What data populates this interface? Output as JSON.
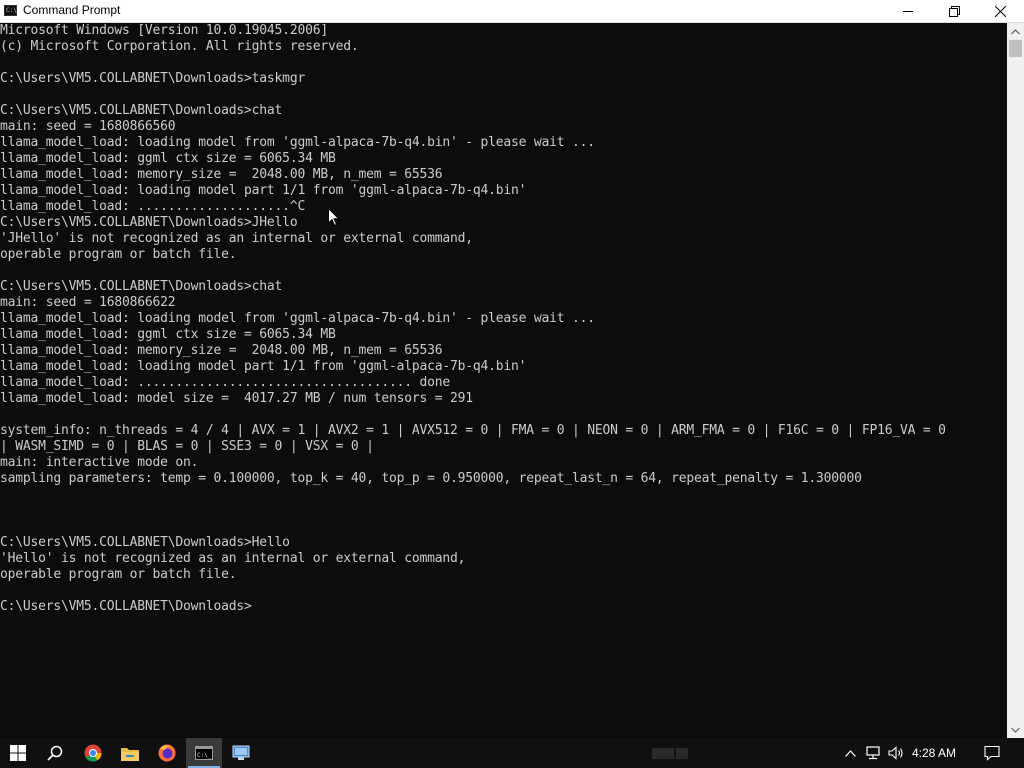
{
  "window": {
    "title": "Command Prompt",
    "app_icon_text": "C:\\"
  },
  "console": {
    "lines": [
      "Microsoft Windows [Version 10.0.19045.2006]",
      "(c) Microsoft Corporation. All rights reserved.",
      "",
      "C:\\Users\\VM5.COLLABNET\\Downloads>taskmgr",
      "",
      "C:\\Users\\VM5.COLLABNET\\Downloads>chat",
      "main: seed = 1680866560",
      "llama_model_load: loading model from 'ggml-alpaca-7b-q4.bin' - please wait ...",
      "llama_model_load: ggml ctx size = 6065.34 MB",
      "llama_model_load: memory_size =  2048.00 MB, n_mem = 65536",
      "llama_model_load: loading model part 1/1 from 'ggml-alpaca-7b-q4.bin'",
      "llama_model_load: ....................^C",
      "C:\\Users\\VM5.COLLABNET\\Downloads>JHello",
      "'JHello' is not recognized as an internal or external command,",
      "operable program or batch file.",
      "",
      "C:\\Users\\VM5.COLLABNET\\Downloads>chat",
      "main: seed = 1680866622",
      "llama_model_load: loading model from 'ggml-alpaca-7b-q4.bin' - please wait ...",
      "llama_model_load: ggml ctx size = 6065.34 MB",
      "llama_model_load: memory_size =  2048.00 MB, n_mem = 65536",
      "llama_model_load: loading model part 1/1 from 'ggml-alpaca-7b-q4.bin'",
      "llama_model_load: .................................... done",
      "llama_model_load: model size =  4017.27 MB / num tensors = 291",
      "",
      "system_info: n_threads = 4 / 4 | AVX = 1 | AVX2 = 1 | AVX512 = 0 | FMA = 0 | NEON = 0 | ARM_FMA = 0 | F16C = 0 | FP16_VA = 0",
      "| WASM_SIMD = 0 | BLAS = 0 | SSE3 = 0 | VSX = 0 |",
      "main: interactive mode on.",
      "sampling parameters: temp = 0.100000, top_k = 40, top_p = 0.950000, repeat_last_n = 64, repeat_penalty = 1.300000",
      "",
      "",
      "",
      "C:\\Users\\VM5.COLLABNET\\Downloads>Hello",
      "'Hello' is not recognized as an internal or external command,",
      "operable program or batch file.",
      "",
      "C:\\Users\\VM5.COLLABNET\\Downloads>"
    ]
  },
  "taskbar": {
    "items": [
      "start",
      "search",
      "chrome",
      "file-explorer",
      "firefox",
      "command-prompt",
      "remote-desktop"
    ],
    "active_item": "command-prompt",
    "clock": "4:28 AM"
  },
  "colors": {
    "console_bg": "#0c0c0c",
    "console_fg": "#cccccc",
    "taskbar_bg": "#101010",
    "accent": "#0078d7"
  }
}
